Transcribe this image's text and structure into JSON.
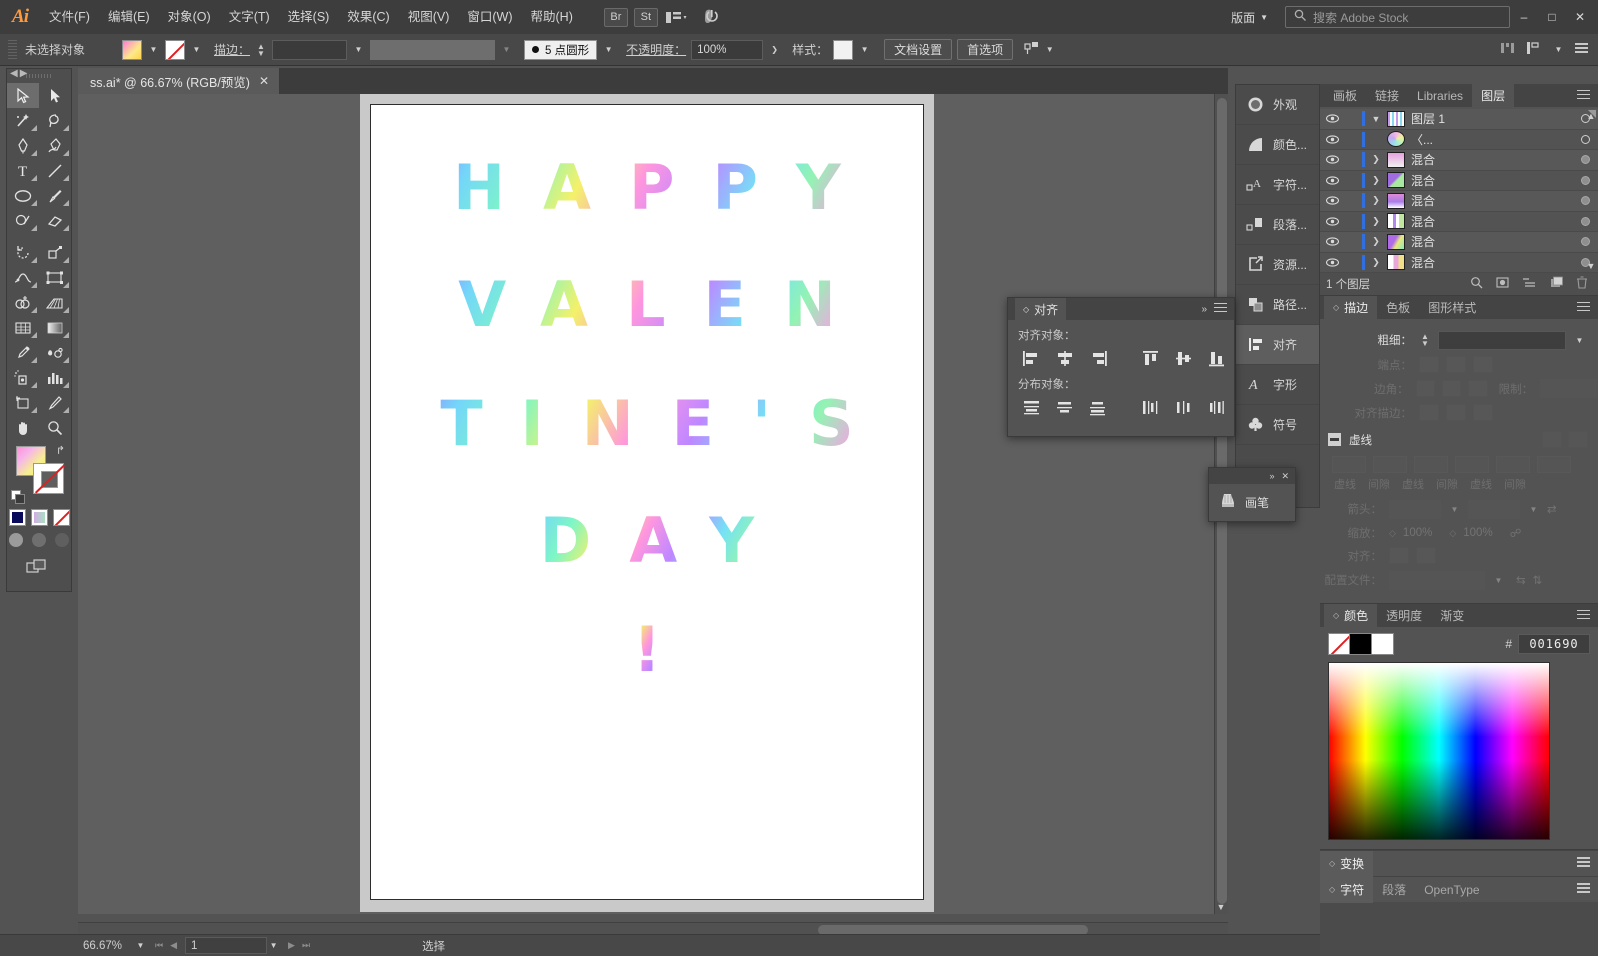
{
  "app": {
    "logo": "Ai"
  },
  "menubar": {
    "items": [
      {
        "label": "文件(F)"
      },
      {
        "label": "编辑(E)"
      },
      {
        "label": "对象(O)"
      },
      {
        "label": "文字(T)"
      },
      {
        "label": "选择(S)"
      },
      {
        "label": "效果(C)"
      },
      {
        "label": "视图(V)"
      },
      {
        "label": "窗口(W)"
      },
      {
        "label": "帮助(H)"
      }
    ],
    "bridge_label": "Br",
    "stock_label": "St",
    "arrange_label": "版面",
    "search_placeholder": "搜索 Adobe Stock",
    "search_value": "",
    "minimize": "–",
    "maximize": "□",
    "close": "✕"
  },
  "controlbar": {
    "selection_status": "未选择对象",
    "stroke_label": "描边：",
    "stroke_weight_value": "",
    "stroke_profile_value": "",
    "brush_value": "5 点圆形",
    "opacity_label": "不透明度：",
    "opacity_value": "100%",
    "style_label": "样式：",
    "doc_setup_label": "文档设置",
    "preferences_label": "首选项"
  },
  "toolbar": {
    "tools": [
      {
        "name": "selection-tool",
        "selected": true
      },
      {
        "name": "direct-selection-tool",
        "selected": false
      },
      {
        "name": "magic-wand-tool",
        "selected": false
      },
      {
        "name": "lasso-tool",
        "selected": false
      },
      {
        "name": "pen-tool",
        "selected": false
      },
      {
        "name": "curvature-tool",
        "selected": false
      },
      {
        "name": "type-tool",
        "selected": false
      },
      {
        "name": "line-segment-tool",
        "selected": false
      },
      {
        "name": "ellipse-tool",
        "selected": false
      },
      {
        "name": "paintbrush-tool",
        "selected": false
      },
      {
        "name": "shaper-tool",
        "selected": false
      },
      {
        "name": "eraser-tool",
        "selected": false
      },
      {
        "name": "rotate-tool",
        "selected": false
      },
      {
        "name": "scale-tool",
        "selected": false
      },
      {
        "name": "width-tool",
        "selected": false
      },
      {
        "name": "free-transform-tool",
        "selected": false
      },
      {
        "name": "shape-builder-tool",
        "selected": false
      },
      {
        "name": "perspective-grid-tool",
        "selected": false
      },
      {
        "name": "mesh-tool",
        "selected": false
      },
      {
        "name": "gradient-tool",
        "selected": false
      },
      {
        "name": "eyedropper-tool",
        "selected": false
      },
      {
        "name": "blend-tool",
        "selected": false
      },
      {
        "name": "symbol-sprayer-tool",
        "selected": false
      },
      {
        "name": "column-graph-tool",
        "selected": false
      },
      {
        "name": "artboard-tool",
        "selected": false
      },
      {
        "name": "slice-tool",
        "selected": false
      },
      {
        "name": "hand-tool",
        "selected": false
      },
      {
        "name": "zoom-tool",
        "selected": false
      }
    ],
    "fill_color": "gradient-pink-yellow",
    "stroke_color": "none",
    "draw_modes": [
      "draw-normal",
      "draw-behind",
      "draw-inside"
    ],
    "screen_modes": [
      "change-screen-mode"
    ]
  },
  "document": {
    "tab_title": "ss.ai* @ 66.67% (RGB/预览)",
    "close_label": "✕"
  },
  "artboard": {
    "lines": [
      "HAPPY",
      "VALEN",
      "TINE'S",
      "DAY",
      "!"
    ],
    "text_full": "HAPPY VALENTINE'S DAY!",
    "gradient": "holographic-rainbow",
    "background": "#ffffff"
  },
  "statusbar": {
    "zoom_value": "66.67%",
    "page_value": "1",
    "status_text": "选择"
  },
  "icondock": {
    "items": [
      {
        "label": "外观",
        "icon": "appearance-icon",
        "active": false
      },
      {
        "label": "颜色...",
        "icon": "color-guide-icon",
        "active": false
      },
      {
        "label": "字符...",
        "icon": "character-styles-icon",
        "active": false
      },
      {
        "label": "段落...",
        "icon": "paragraph-styles-icon",
        "active": false
      },
      {
        "label": "资源...",
        "icon": "asset-export-icon",
        "active": false
      },
      {
        "label": "路径...",
        "icon": "pathfinder-icon",
        "active": false
      },
      {
        "label": "对齐",
        "icon": "align-icon",
        "active": true
      },
      {
        "label": "字形",
        "icon": "glyphs-icon",
        "active": false
      },
      {
        "label": "符号",
        "icon": "symbols-icon",
        "active": false
      }
    ]
  },
  "align_panel": {
    "title": "对齐",
    "align_objects_label": "对齐对象：",
    "distribute_objects_label": "分布对象：",
    "align_buttons": [
      "align-left",
      "align-horizontal-center",
      "align-right",
      "align-top",
      "align-vertical-center",
      "align-bottom"
    ],
    "distribute_buttons": [
      "distribute-top",
      "distribute-vertical-center",
      "distribute-bottom",
      "distribute-left",
      "distribute-horizontal-center",
      "distribute-right"
    ],
    "collapse": "»",
    "menu": "≡"
  },
  "brush_panel": {
    "title": "画笔",
    "collapse": "»",
    "close": "✕"
  },
  "layers_panel": {
    "tabs": [
      {
        "label": "画板",
        "active": false
      },
      {
        "label": "链接",
        "active": false
      },
      {
        "label": "Libraries",
        "active": false
      },
      {
        "label": "图层",
        "active": true
      }
    ],
    "rows": [
      {
        "name": "图层 1",
        "expanded": true,
        "thumb": "layer-thumb-all",
        "target": "empty",
        "indent": 0
      },
      {
        "name": "〈...",
        "expanded": false,
        "thumb": "layer-thumb-circle",
        "target": "empty",
        "indent": 1
      },
      {
        "name": "混合",
        "expanded": false,
        "thumb": "layer-thumb-blend-1",
        "target": "filled",
        "indent": 1
      },
      {
        "name": "混合",
        "expanded": false,
        "thumb": "layer-thumb-blend-2",
        "target": "filled",
        "indent": 1
      },
      {
        "name": "混合",
        "expanded": false,
        "thumb": "layer-thumb-blend-3",
        "target": "filled",
        "indent": 1
      },
      {
        "name": "混合",
        "expanded": false,
        "thumb": "layer-thumb-blend-4",
        "target": "filled",
        "indent": 1
      },
      {
        "name": "混合",
        "expanded": false,
        "thumb": "layer-thumb-blend-5",
        "target": "filled",
        "indent": 1
      },
      {
        "name": "混合",
        "expanded": false,
        "thumb": "layer-thumb-blend-6",
        "target": "filled",
        "indent": 1
      }
    ],
    "footer_count": "1 个图层",
    "footer_icons": [
      "locate-object-icon",
      "make-clipping-mask-icon",
      "create-sublayer-icon",
      "create-new-layer-icon",
      "delete-selection-icon"
    ]
  },
  "stroke_panel": {
    "tabs": [
      {
        "label": "描边",
        "active": true
      },
      {
        "label": "色板",
        "active": false
      },
      {
        "label": "图形样式",
        "active": false
      }
    ],
    "weight_label": "粗细：",
    "weight_value": "",
    "cap_label": "端点：",
    "corner_label": "边角：",
    "limit_label": "限制：",
    "limit_value": "",
    "align_stroke_label": "对齐描边：",
    "dashed_label": "虚线",
    "dash_labels": [
      "虚线",
      "间隙",
      "虚线",
      "间隙",
      "虚线",
      "间隙"
    ],
    "arrowheads_label": "箭头：",
    "scale_label": "缩放：",
    "scale_value_1": "100%",
    "scale_value_2": "100%",
    "align_label": "对齐：",
    "profile_label": "配置文件："
  },
  "color_panel": {
    "tabs": [
      {
        "label": "颜色",
        "active": true
      },
      {
        "label": "透明度",
        "active": false
      },
      {
        "label": "渐变",
        "active": false
      }
    ],
    "hex_symbol": "#",
    "hex_value": "001690",
    "swatches": [
      "none-swatch",
      "black-swatch",
      "white-swatch"
    ]
  },
  "transform_panel": {
    "tabs": [
      {
        "label": "变换",
        "active": true
      }
    ]
  },
  "character_panel": {
    "tabs": [
      {
        "label": "字符",
        "active": true
      },
      {
        "label": "段落",
        "active": false
      },
      {
        "label": "OpenType",
        "active": false
      }
    ]
  }
}
